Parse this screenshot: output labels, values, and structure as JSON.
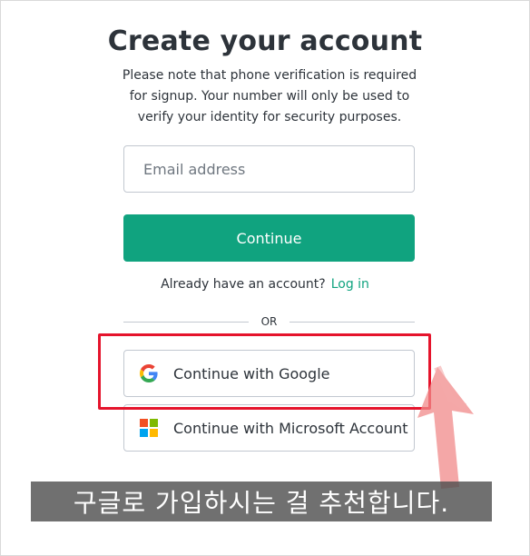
{
  "page": {
    "title": "Create your account",
    "subtitle": "Please note that phone verification is required for signup. Your number will only be used to verify your identity for security purposes."
  },
  "form": {
    "email_placeholder": "Email address",
    "email_value": "",
    "continue_label": "Continue"
  },
  "login": {
    "prompt": "Already have an account?",
    "link_label": "Log in"
  },
  "divider": {
    "label": "OR"
  },
  "social": {
    "google_label": "Continue with Google",
    "google_icon": "google-icon",
    "microsoft_label": "Continue with Microsoft Account",
    "microsoft_icon": "microsoft-icon"
  },
  "annotation": {
    "caption": "구글로 가입하시는 걸 추천합니다.",
    "highlight_color": "#e5142c",
    "arrow_color": "#f08a8a"
  },
  "colors": {
    "accent": "#10a37f",
    "text": "#2d333a",
    "border": "#c2c8d0"
  }
}
